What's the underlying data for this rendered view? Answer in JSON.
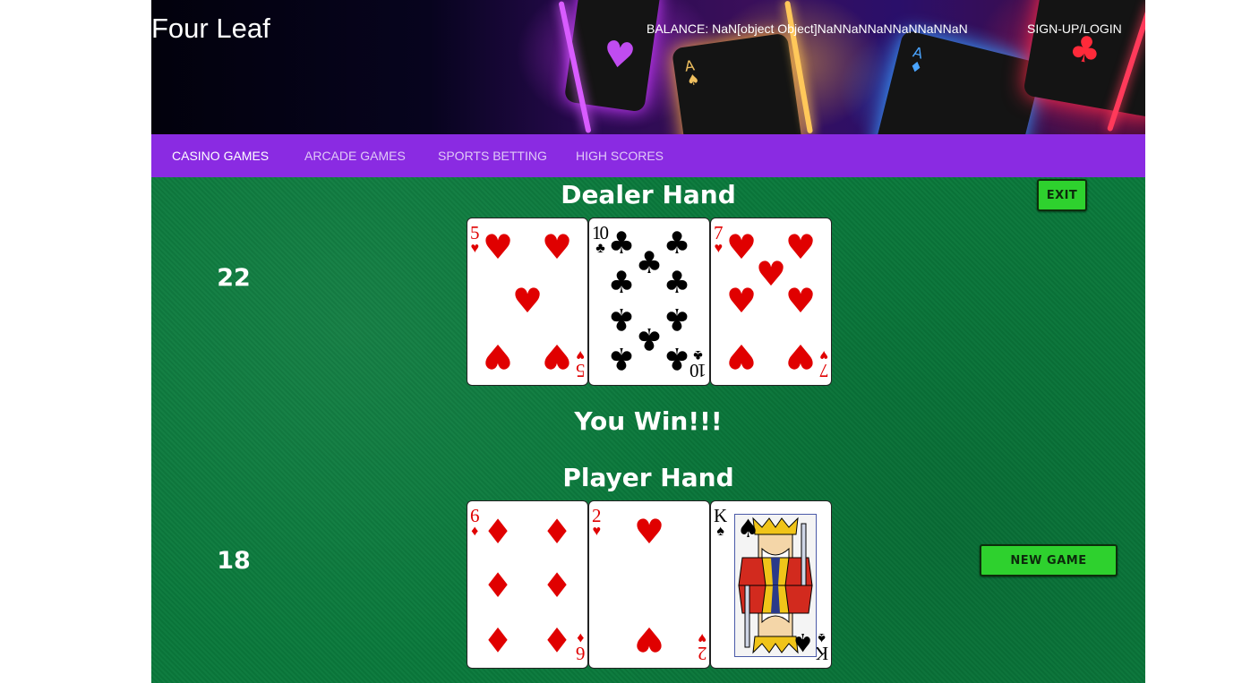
{
  "header": {
    "logo": "Four Leaf",
    "balance": "BALANCE: NaN[object Object]NaNNaNNaNNaNNaNNaN",
    "login": "SIGN-UP/LOGIN"
  },
  "nav": {
    "items": [
      {
        "label": "CASINO GAMES",
        "active": true
      },
      {
        "label": "ARCADE GAMES",
        "active": false
      },
      {
        "label": "SPORTS BETTING",
        "active": false
      },
      {
        "label": "HIGH SCORES",
        "active": false
      }
    ]
  },
  "game": {
    "dealer_heading": "Dealer Hand",
    "dealer_score": "22",
    "dealer_cards": [
      {
        "rank": "5",
        "suit": "♥",
        "color": "red"
      },
      {
        "rank": "10",
        "suit": "♣",
        "color": "black"
      },
      {
        "rank": "7",
        "suit": "♥",
        "color": "red"
      }
    ],
    "result": "You Win!!!",
    "player_heading": "Player Hand",
    "player_score": "18",
    "player_cards": [
      {
        "rank": "6",
        "suit": "♦",
        "color": "red"
      },
      {
        "rank": "2",
        "suit": "♥",
        "color": "red"
      },
      {
        "rank": "K",
        "suit": "♠",
        "color": "black"
      }
    ],
    "exit_label": "EXIT",
    "new_game_label": "NEW GAME"
  },
  "colors": {
    "nav_bg": "#8a2be2",
    "felt": "#0a7a3c",
    "button": "#2ed12e",
    "card_red": "#e00000"
  }
}
